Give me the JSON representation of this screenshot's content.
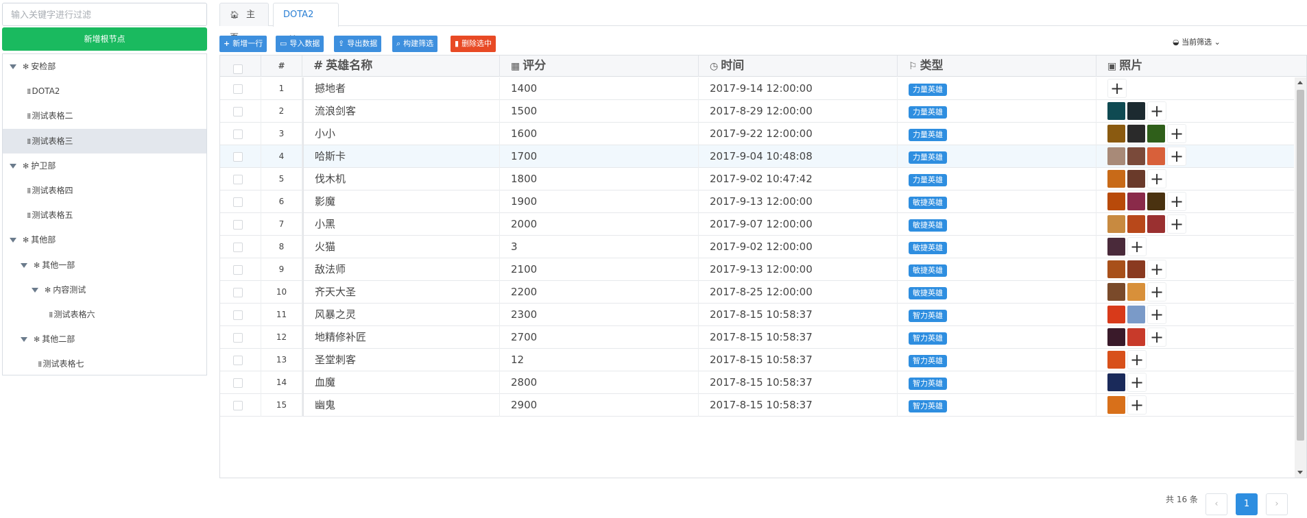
{
  "sidebar": {
    "filter_placeholder": "输入关键字进行过滤",
    "add_root_label": "新增根节点",
    "tree": [
      {
        "label": "安检部",
        "type": "folder",
        "level": 0,
        "expanded": true
      },
      {
        "label": "DOTA2",
        "type": "leaf",
        "level": 1
      },
      {
        "label": "测试表格二",
        "type": "leaf",
        "level": 1
      },
      {
        "label": "测试表格三",
        "type": "leaf",
        "level": 1,
        "selected": true
      },
      {
        "label": "护卫部",
        "type": "folder",
        "level": 0,
        "expanded": true
      },
      {
        "label": "测试表格四",
        "type": "leaf",
        "level": 1
      },
      {
        "label": "测试表格五",
        "type": "leaf",
        "level": 1
      },
      {
        "label": "其他部",
        "type": "folder",
        "level": 0,
        "expanded": true
      },
      {
        "label": "其他一部",
        "type": "folder",
        "level": 1,
        "expanded": true
      },
      {
        "label": "内容测试",
        "type": "folder",
        "level": 2,
        "expanded": true
      },
      {
        "label": "测试表格六",
        "type": "leaf",
        "level": 3
      },
      {
        "label": "其他二部",
        "type": "folder",
        "level": 1,
        "expanded": true
      },
      {
        "label": "测试表格七",
        "type": "leaf",
        "level": 2
      }
    ]
  },
  "tabs": [
    {
      "label": "主页",
      "icon": "home-icon",
      "active": false
    },
    {
      "label": "DOTA2",
      "closable": true,
      "active": true
    }
  ],
  "toolbar": {
    "buttons": [
      {
        "label": "新增一行",
        "icon": "plus-icon",
        "color": "#3d8fde"
      },
      {
        "label": "导入数据",
        "icon": "import-icon",
        "color": "#3d8fde"
      },
      {
        "label": "导出数据",
        "icon": "export-icon",
        "color": "#3d8fde"
      },
      {
        "label": "构建筛选",
        "icon": "search-icon",
        "color": "#3d8fde"
      },
      {
        "label": "删除选中",
        "icon": "trash-icon",
        "color": "#e84a25"
      }
    ],
    "current_filter_label": "当前筛选"
  },
  "table": {
    "columns": [
      {
        "label": "",
        "key": "check"
      },
      {
        "label": "#",
        "key": "index"
      },
      {
        "label": "英雄名称",
        "key": "name",
        "icon": "hash-icon"
      },
      {
        "label": "评分",
        "key": "score",
        "icon": "calculator-icon"
      },
      {
        "label": "时间",
        "key": "time",
        "icon": "clock-icon"
      },
      {
        "label": "类型",
        "key": "type",
        "icon": "flag-icon"
      },
      {
        "label": "照片",
        "key": "photos",
        "icon": "image-icon"
      }
    ],
    "rows": [
      {
        "index": "1",
        "name": "撼地者",
        "score": "1400",
        "time": "2017-9-14 12:00:00",
        "type": "力量英雄",
        "photos": []
      },
      {
        "index": "2",
        "name": "流浪剑客",
        "score": "1500",
        "time": "2017-8-29 12:00:00",
        "type": "力量英雄",
        "photos": [
          "#0f4a52",
          "#1c2a30"
        ]
      },
      {
        "index": "3",
        "name": "小小",
        "score": "1600",
        "time": "2017-9-22 12:00:00",
        "type": "力量英雄",
        "photos": [
          "#8a5a10",
          "#2a2a2a",
          "#2f5f1a"
        ]
      },
      {
        "index": "4",
        "name": "哈斯卡",
        "score": "1700",
        "time": "2017-9-04 10:48:08",
        "type": "力量英雄",
        "highlight": true,
        "photos": [
          "#a88a78",
          "#7a4a3a",
          "#d8603a"
        ]
      },
      {
        "index": "5",
        "name": "伐木机",
        "score": "1800",
        "time": "2017-9-02 10:47:42",
        "type": "力量英雄",
        "photos": [
          "#c86a18",
          "#6a3a2a"
        ]
      },
      {
        "index": "6",
        "name": "影魔",
        "score": "1900",
        "time": "2017-9-13 12:00:00",
        "type": "敏捷英雄",
        "photos": [
          "#b84a0a",
          "#8a2a4a",
          "#4a3210"
        ]
      },
      {
        "index": "7",
        "name": "小黑",
        "score": "2000",
        "time": "2017-9-07 12:00:00",
        "type": "敏捷英雄",
        "photos": [
          "#c88a40",
          "#b8481a",
          "#9a3030"
        ]
      },
      {
        "index": "8",
        "name": "火猫",
        "score": "3",
        "time": "2017-9-02 12:00:00",
        "type": "敏捷英雄",
        "photos": [
          "#4a2a3a"
        ]
      },
      {
        "index": "9",
        "name": "敌法师",
        "score": "2100",
        "time": "2017-9-13 12:00:00",
        "type": "敏捷英雄",
        "photos": [
          "#a8501a",
          "#8a3a20"
        ]
      },
      {
        "index": "10",
        "name": "齐天大圣",
        "score": "2200",
        "time": "2017-8-25 12:00:00",
        "type": "敏捷英雄",
        "photos": [
          "#7a4a2a",
          "#d8903a"
        ]
      },
      {
        "index": "11",
        "name": "风暴之灵",
        "score": "2300",
        "time": "2017-8-15 10:58:37",
        "type": "智力英雄",
        "photos": [
          "#d83a1a",
          "#7a9ac8"
        ]
      },
      {
        "index": "12",
        "name": "地精修补匠",
        "score": "2700",
        "time": "2017-8-15 10:58:37",
        "type": "智力英雄",
        "photos": [
          "#3a1a2a",
          "#c83a2a"
        ]
      },
      {
        "index": "13",
        "name": "圣堂刺客",
        "score": "12",
        "time": "2017-8-15 10:58:37",
        "type": "智力英雄",
        "photos": [
          "#d8501a"
        ]
      },
      {
        "index": "14",
        "name": "血魔",
        "score": "2800",
        "time": "2017-8-15 10:58:37",
        "type": "智力英雄",
        "photos": [
          "#1a2a5a"
        ]
      },
      {
        "index": "15",
        "name": "幽鬼",
        "score": "2900",
        "time": "2017-8-15 10:58:37",
        "type": "智力英雄",
        "photos": [
          "#d8701a"
        ]
      }
    ]
  },
  "pagination": {
    "total_label": "共 16 条",
    "current_page": "1",
    "prev": "‹",
    "next": "›"
  }
}
